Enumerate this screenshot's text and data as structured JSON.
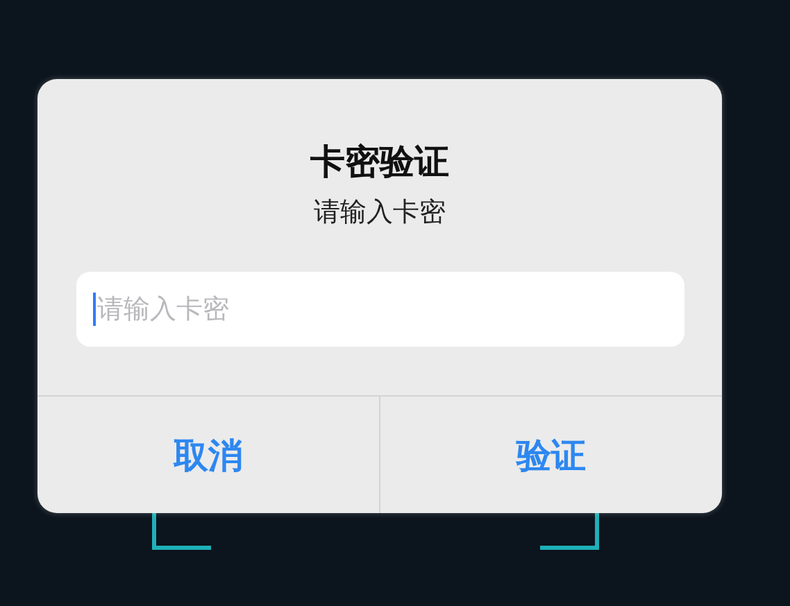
{
  "dialog": {
    "title": "卡密验证",
    "message": "请输入卡密",
    "input": {
      "placeholder": "请输入卡密",
      "focused": true
    },
    "buttons": [
      {
        "label": "取消"
      },
      {
        "label": "验证"
      }
    ]
  }
}
